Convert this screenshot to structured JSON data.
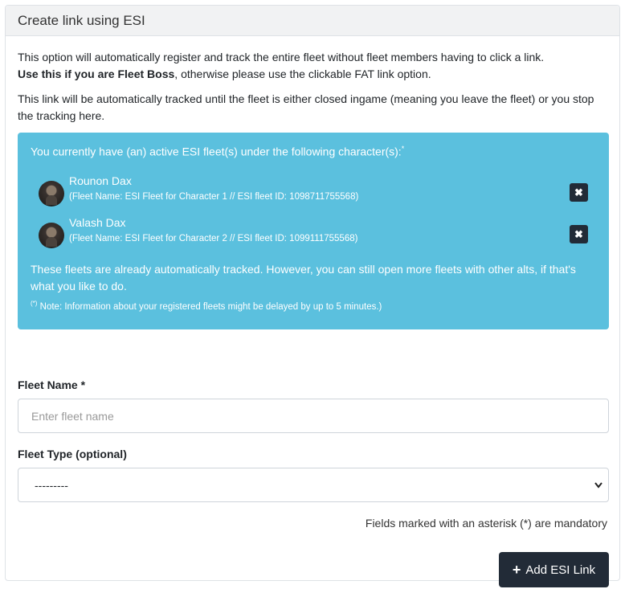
{
  "panel": {
    "title": "Create link using ESI"
  },
  "intro": {
    "line1": "This option will automatically register and track the entire fleet without fleet members having to click a link.",
    "bold": "Use this if you are Fleet Boss",
    "rest": ", otherwise please use the clickable FAT link option.",
    "line2": "This link will be automatically tracked until the fleet is either closed ingame (meaning you leave the fleet) or you stop the tracking here."
  },
  "alert": {
    "heading": "You currently have (an) active ESI fleet(s) under the following character(s):",
    "heading_sup": "*",
    "fleets": [
      {
        "name": "Rounon Dax",
        "info": "(Fleet Name: ESI Fleet for Character 1 // ESI fleet ID: 1098711755568)",
        "close_icon": "close-icon"
      },
      {
        "name": "Valash Dax",
        "info": "(Fleet Name: ESI Fleet for Character 2 // ESI fleet ID: 1099111755568)",
        "close_icon": "close-icon"
      }
    ],
    "text": "These fleets are already automatically tracked. However, you can still open more fleets with other alts, if that's what you like to do.",
    "note_sup": "(*)",
    "note": " Note: Information about your registered fleets might be delayed by up to 5 minutes.)",
    "color": "#5bc0de"
  },
  "form": {
    "fleet_name_label": "Fleet Name *",
    "fleet_name_placeholder": "Enter fleet name",
    "fleet_name_value": "",
    "fleet_type_label": "Fleet Type (optional)",
    "fleet_type_value": "---------",
    "mandatory_note": "Fields marked with an asterisk (*) are mandatory",
    "submit_label": "Add ESI Link",
    "submit_icon": "plus-icon",
    "button_color": "#222b37"
  }
}
